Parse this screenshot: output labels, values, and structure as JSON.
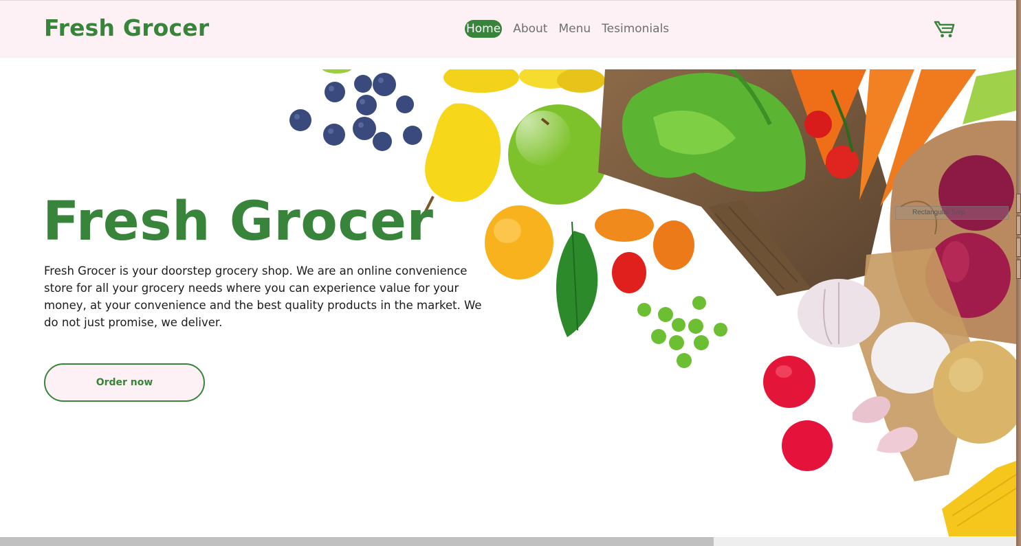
{
  "header": {
    "brand": "Fresh Grocer",
    "nav": [
      {
        "label": "Home",
        "active": true
      },
      {
        "label": "About",
        "active": false
      },
      {
        "label": "Menu",
        "active": false
      },
      {
        "label": "Tesimonials",
        "active": false
      }
    ],
    "cart_icon": "shopping-cart-icon"
  },
  "hero": {
    "title": "Fresh Grocer",
    "description": "Fresh Grocer is your doorstep grocery shop. We are an online convenience store for all your grocery needs where you can experience value for your money, at your convenience and the best quality products in the market. We do not just promise, we deliver.",
    "cta_label": "Order now",
    "image": "fresh-vegetables-and-fruits-image"
  },
  "overlay": {
    "snip_tooltip": "Rectangular Snip"
  },
  "colors": {
    "brand_green": "#37843a",
    "header_bg": "#fdf1f5",
    "text": "#1c1c1c",
    "nav_text": "#6f6f6f"
  }
}
